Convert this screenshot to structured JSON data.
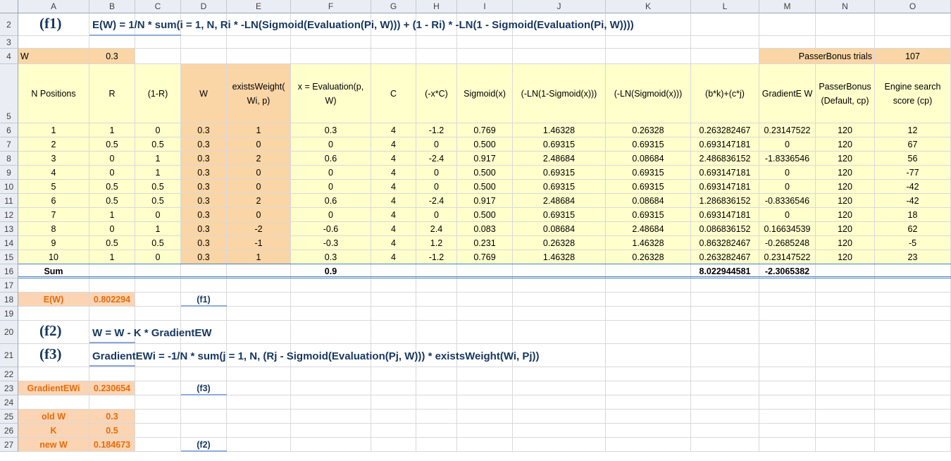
{
  "columns": [
    "A",
    "B",
    "C",
    "D",
    "E",
    "F",
    "G",
    "H",
    "I",
    "J",
    "K",
    "L",
    "M",
    "N",
    "O"
  ],
  "rows": [
    "2",
    "3",
    "4",
    "5",
    "6",
    "7",
    "8",
    "9",
    "10",
    "11",
    "12",
    "13",
    "14",
    "15",
    "16",
    "17",
    "18",
    "19",
    "20",
    "21",
    "22",
    "23",
    "24",
    "25",
    "26",
    "27"
  ],
  "f1": {
    "label": "(f1)",
    "formula": "E(W) = 1/N * sum(i = 1, N, Ri * -LN(Sigmoid(Evaluation(Pi, W))) + (1 - Ri) * -LN(1 - Sigmoid(Evaluation(Pi, W))))"
  },
  "f2": {
    "label": "(f2)",
    "formula": "W = W - K * GradientEW"
  },
  "f3": {
    "label": "(f3)",
    "formula": "GradientEWi = -1/N * sum(j = 1, N, (Rj - Sigmoid(Evaluation(Pj, W))) * existsWeight(Wi, Pj))"
  },
  "row4": {
    "w_label": "W",
    "w_value": "0.3",
    "passer_label": "PasserBonus trials",
    "passer_value": "107"
  },
  "table": {
    "headers": [
      "N Positions",
      "R",
      "(1-R)",
      "W",
      "existsWeight( Wi, p)",
      "x = Evaluation(p, W)",
      "C",
      "(-x*C)",
      "Sigmoid(x)",
      "(-LN(1-Sigmoid(x)))",
      "(-LN(Sigmoid(x)))",
      "(b*k)+(c*j)",
      "GradientE W",
      "PasserBonus (Default, cp)",
      "Engine search score (cp)"
    ],
    "rows": [
      [
        "1",
        "1",
        "0",
        "0.3",
        "1",
        "0.3",
        "4",
        "-1.2",
        "0.769",
        "1.46328",
        "0.26328",
        "0.263282467",
        "0.23147522",
        "120",
        "12"
      ],
      [
        "2",
        "0.5",
        "0.5",
        "0.3",
        "0",
        "0",
        "4",
        "0",
        "0.500",
        "0.69315",
        "0.69315",
        "0.693147181",
        "0",
        "120",
        "67"
      ],
      [
        "3",
        "0",
        "1",
        "0.3",
        "2",
        "0.6",
        "4",
        "-2.4",
        "0.917",
        "2.48684",
        "0.08684",
        "2.486836152",
        "-1.8336546",
        "120",
        "56"
      ],
      [
        "4",
        "0",
        "1",
        "0.3",
        "0",
        "0",
        "4",
        "0",
        "0.500",
        "0.69315",
        "0.69315",
        "0.693147181",
        "0",
        "120",
        "-77"
      ],
      [
        "5",
        "0.5",
        "0.5",
        "0.3",
        "0",
        "0",
        "4",
        "0",
        "0.500",
        "0.69315",
        "0.69315",
        "0.693147181",
        "0",
        "120",
        "-42"
      ],
      [
        "6",
        "0.5",
        "0.5",
        "0.3",
        "2",
        "0.6",
        "4",
        "-2.4",
        "0.917",
        "2.48684",
        "0.08684",
        "1.286836152",
        "-0.8336546",
        "120",
        "-42"
      ],
      [
        "7",
        "1",
        "0",
        "0.3",
        "0",
        "0",
        "4",
        "0",
        "0.500",
        "0.69315",
        "0.69315",
        "0.693147181",
        "0",
        "120",
        "18"
      ],
      [
        "8",
        "0",
        "1",
        "0.3",
        "-2",
        "-0.6",
        "4",
        "2.4",
        "0.083",
        "0.08684",
        "2.48684",
        "0.086836152",
        "0.16634539",
        "120",
        "62"
      ],
      [
        "9",
        "0.5",
        "0.5",
        "0.3",
        "-1",
        "-0.3",
        "4",
        "1.2",
        "0.231",
        "0.26328",
        "1.46328",
        "0.863282467",
        "-0.2685248",
        "120",
        "-5"
      ],
      [
        "10",
        "1",
        "0",
        "0.3",
        "1",
        "0.3",
        "4",
        "-1.2",
        "0.769",
        "1.46328",
        "0.26328",
        "0.263282467",
        "0.23147522",
        "120",
        "23"
      ]
    ],
    "sum": {
      "label": "Sum",
      "f": "0.9",
      "l": "8.022944581",
      "m": "-2.3065382"
    }
  },
  "results": {
    "ew_label": "E(W)",
    "ew_value": "0.802294",
    "ew_ref": "(f1)",
    "grad_label": "GradientEWi",
    "grad_value": "0.230654",
    "grad_ref": "(f3)",
    "oldw_label": "old W",
    "oldw_value": "0.3",
    "k_label": "K",
    "k_value": "0.5",
    "neww_label": "new W",
    "neww_value": "0.184673",
    "neww_ref": "(f2)"
  }
}
